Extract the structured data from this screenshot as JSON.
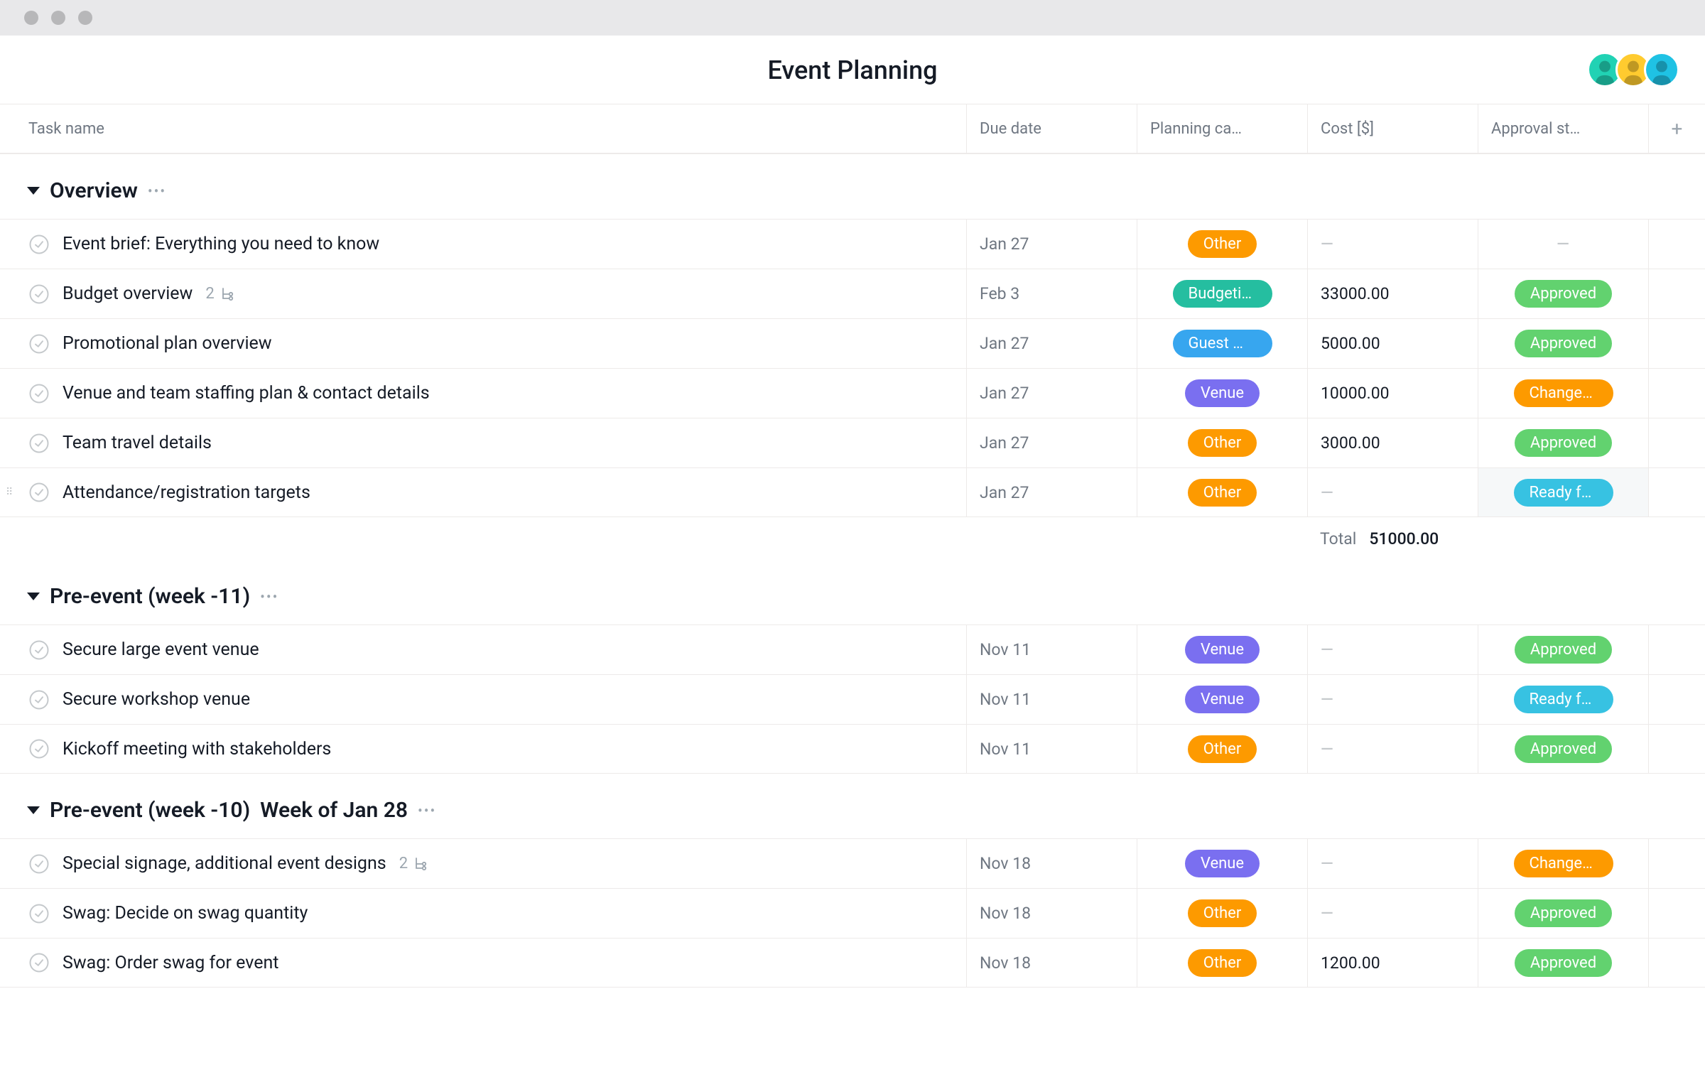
{
  "page_title": "Event Planning",
  "columns": {
    "task": "Task name",
    "due": "Due date",
    "category": "Planning ca…",
    "cost": "Cost [$]",
    "status": "Approval st…"
  },
  "category_colors": {
    "Other": "#fd9a00",
    "Budgeting": "#25bea0",
    "Guest m…": "#37a6ef",
    "Venue": "#7a6ff0"
  },
  "status_colors": {
    "Approved": "#62d26f",
    "Changes…": "#fd9a00",
    "Ready fo…": "#37c2e2"
  },
  "avatars": [
    {
      "bg": "#21d2b4"
    },
    {
      "bg": "#ffcb2f"
    },
    {
      "bg": "#1fc2e4"
    }
  ],
  "sections": [
    {
      "title": "Overview",
      "week": "",
      "tasks": [
        {
          "name": "Event brief: Everything you need to know",
          "due": "Jan 27",
          "category": "Other",
          "cost": "",
          "status": ""
        },
        {
          "name": "Budget overview",
          "subtasks": "2",
          "due": "Feb 3",
          "category": "Budgeting",
          "cost": "33000.00",
          "status": "Approved"
        },
        {
          "name": "Promotional plan overview",
          "due": "Jan 27",
          "category": "Guest m…",
          "cost": "5000.00",
          "status": "Approved"
        },
        {
          "name": "Venue and team staffing plan & contact details",
          "due": "Jan 27",
          "category": "Venue",
          "cost": "10000.00",
          "status": "Changes…"
        },
        {
          "name": "Team travel details",
          "due": "Jan 27",
          "category": "Other",
          "cost": "3000.00",
          "status": "Approved"
        },
        {
          "name": "Attendance/registration targets",
          "due": "Jan 27",
          "category": "Other",
          "cost": "",
          "status": "Ready fo…",
          "show_drag": true,
          "highlight": true
        }
      ],
      "total_label": "Total",
      "total": "51000.00"
    },
    {
      "title": "Pre-event (week -11)",
      "week": "",
      "tasks": [
        {
          "name": "Secure large event venue",
          "due": "Nov 11",
          "category": "Venue",
          "cost": "",
          "status": "Approved"
        },
        {
          "name": "Secure workshop venue",
          "due": "Nov 11",
          "category": "Venue",
          "cost": "",
          "status": "Ready fo…"
        },
        {
          "name": "Kickoff meeting with stakeholders",
          "due": "Nov 11",
          "category": "Other",
          "cost": "",
          "status": "Approved"
        }
      ]
    },
    {
      "title": "Pre-event (week -10)",
      "week": "Week of Jan 28",
      "tasks": [
        {
          "name": "Special signage, additional event designs",
          "subtasks": "2",
          "due": "Nov 18",
          "category": "Venue",
          "cost": "",
          "status": "Changes…"
        },
        {
          "name": "Swag: Decide on swag quantity",
          "due": "Nov 18",
          "category": "Other",
          "cost": "",
          "status": "Approved"
        },
        {
          "name": "Swag: Order swag for event",
          "due": "Nov 18",
          "category": "Other",
          "cost": "1200.00",
          "status": "Approved"
        }
      ]
    }
  ]
}
